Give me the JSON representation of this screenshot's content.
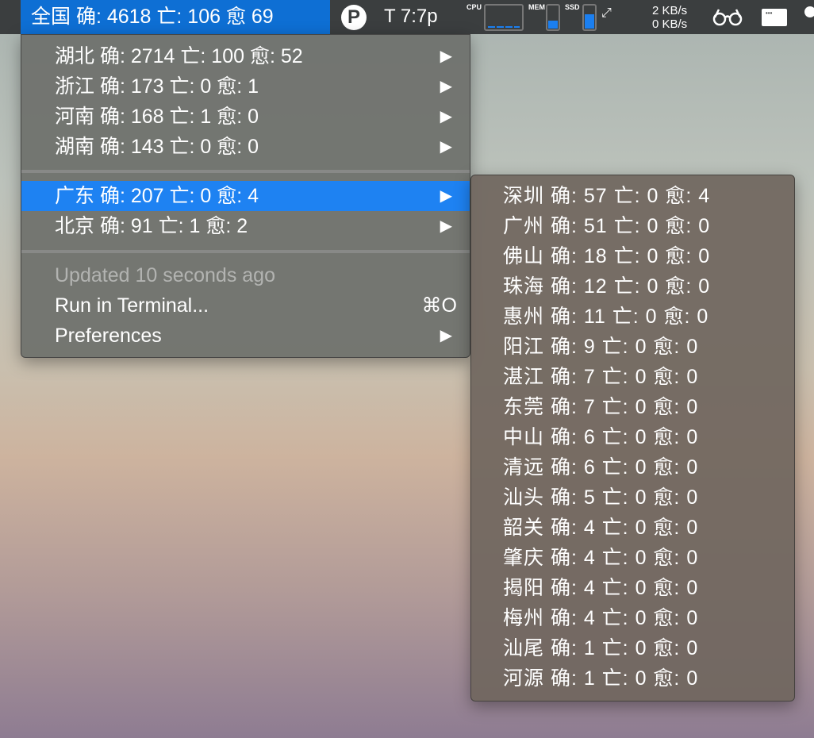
{
  "menubar": {
    "title": "全国 确: 4618 亡: 106 愈 69",
    "p_icon": "P",
    "time_label": "T 7:7p",
    "cpu_label": "CPU",
    "mem_label": "MEM",
    "ssd_label": "SSD",
    "mem_fill": 0.35,
    "ssd_fill": 0.6,
    "net_up": "2 KB/s",
    "net_down": "0 KB/s",
    "accent": "#0e6fd4"
  },
  "menu": {
    "provinces": [
      {
        "label": "湖北 确: 2714 亡: 100 愈: 52"
      },
      {
        "label": "浙江 确: 173 亡: 0 愈: 1"
      },
      {
        "label": "河南 确: 168 亡: 1 愈: 0"
      },
      {
        "label": "湖南 确: 143 亡: 0 愈: 0"
      },
      {
        "label": "广东 确: 207 亡: 0 愈: 4"
      },
      {
        "label": "北京 确: 91 亡: 1 愈: 2"
      }
    ],
    "arrow": "▶",
    "updated": "Updated 10 seconds ago",
    "run_terminal": "Run in Terminal...",
    "run_shortcut": "⌘O",
    "preferences": "Preferences"
  },
  "submenu": {
    "cities": [
      "深圳 确: 57 亡: 0 愈: 4",
      "广州 确: 51 亡: 0 愈: 0",
      "佛山 确: 18 亡: 0 愈: 0",
      "珠海 确: 12 亡: 0 愈: 0",
      "惠州 确: 11 亡: 0 愈: 0",
      "阳江 确: 9 亡: 0 愈: 0",
      "湛江 确: 7 亡: 0 愈: 0",
      "东莞 确: 7 亡: 0 愈: 0",
      "中山 确: 6 亡: 0 愈: 0",
      "清远 确: 6 亡: 0 愈: 0",
      "汕头 确: 5 亡: 0 愈: 0",
      "韶关 确: 4 亡: 0 愈: 0",
      "肇庆 确: 4 亡: 0 愈: 0",
      "揭阳 确: 4 亡: 0 愈: 0",
      "梅州 确: 4 亡: 0 愈: 0",
      "汕尾 确: 1 亡: 0 愈: 0",
      "河源 确: 1 亡: 0 愈: 0"
    ]
  }
}
